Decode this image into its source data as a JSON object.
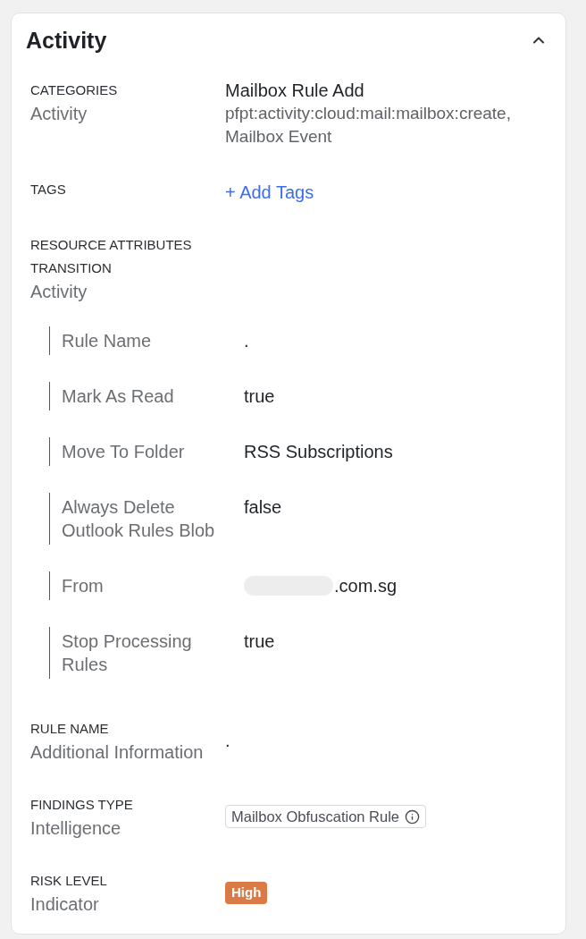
{
  "panel": {
    "title": "Activity",
    "expanded": true
  },
  "sections": [
    {
      "kind": "detail",
      "label": "CATEGORIES",
      "sublabel": "Activity",
      "value": "Mailbox Rule Add",
      "details": [
        "pfpt:activity:cloud:mail:mailbox:create,",
        "Mailbox Event"
      ]
    },
    {
      "kind": "link",
      "label": "TAGS",
      "value": "+ Add Tags"
    },
    {
      "kind": "attributes",
      "label": "RESOURCE ATTRIBUTES TRANSITION",
      "sublabel": "Activity",
      "attributes": [
        {
          "name": "Rule Name",
          "value": ".",
          "redacted": false
        },
        {
          "name": "Mark As Read",
          "value": "true",
          "redacted": false
        },
        {
          "name": "Move To Folder",
          "value": "RSS Subscriptions",
          "redacted": false
        },
        {
          "name": "Always Delete Outlook Rules Blob",
          "value": "false",
          "redacted": false
        },
        {
          "name": "From",
          "value": ".com.sg",
          "redacted": true
        },
        {
          "name": "Stop Processing Rules",
          "value": "true",
          "redacted": false
        }
      ]
    },
    {
      "kind": "text",
      "label": "RULE NAME",
      "sublabel": "Additional Information",
      "value": "."
    },
    {
      "kind": "tag",
      "label": "FINDINGS TYPE",
      "sublabel": "Intelligence",
      "value": "Mailbox Obfuscation Rule"
    },
    {
      "kind": "badge",
      "label": "RISK LEVEL",
      "sublabel": "Indicator",
      "value": "High",
      "color": "#d97a47"
    }
  ]
}
